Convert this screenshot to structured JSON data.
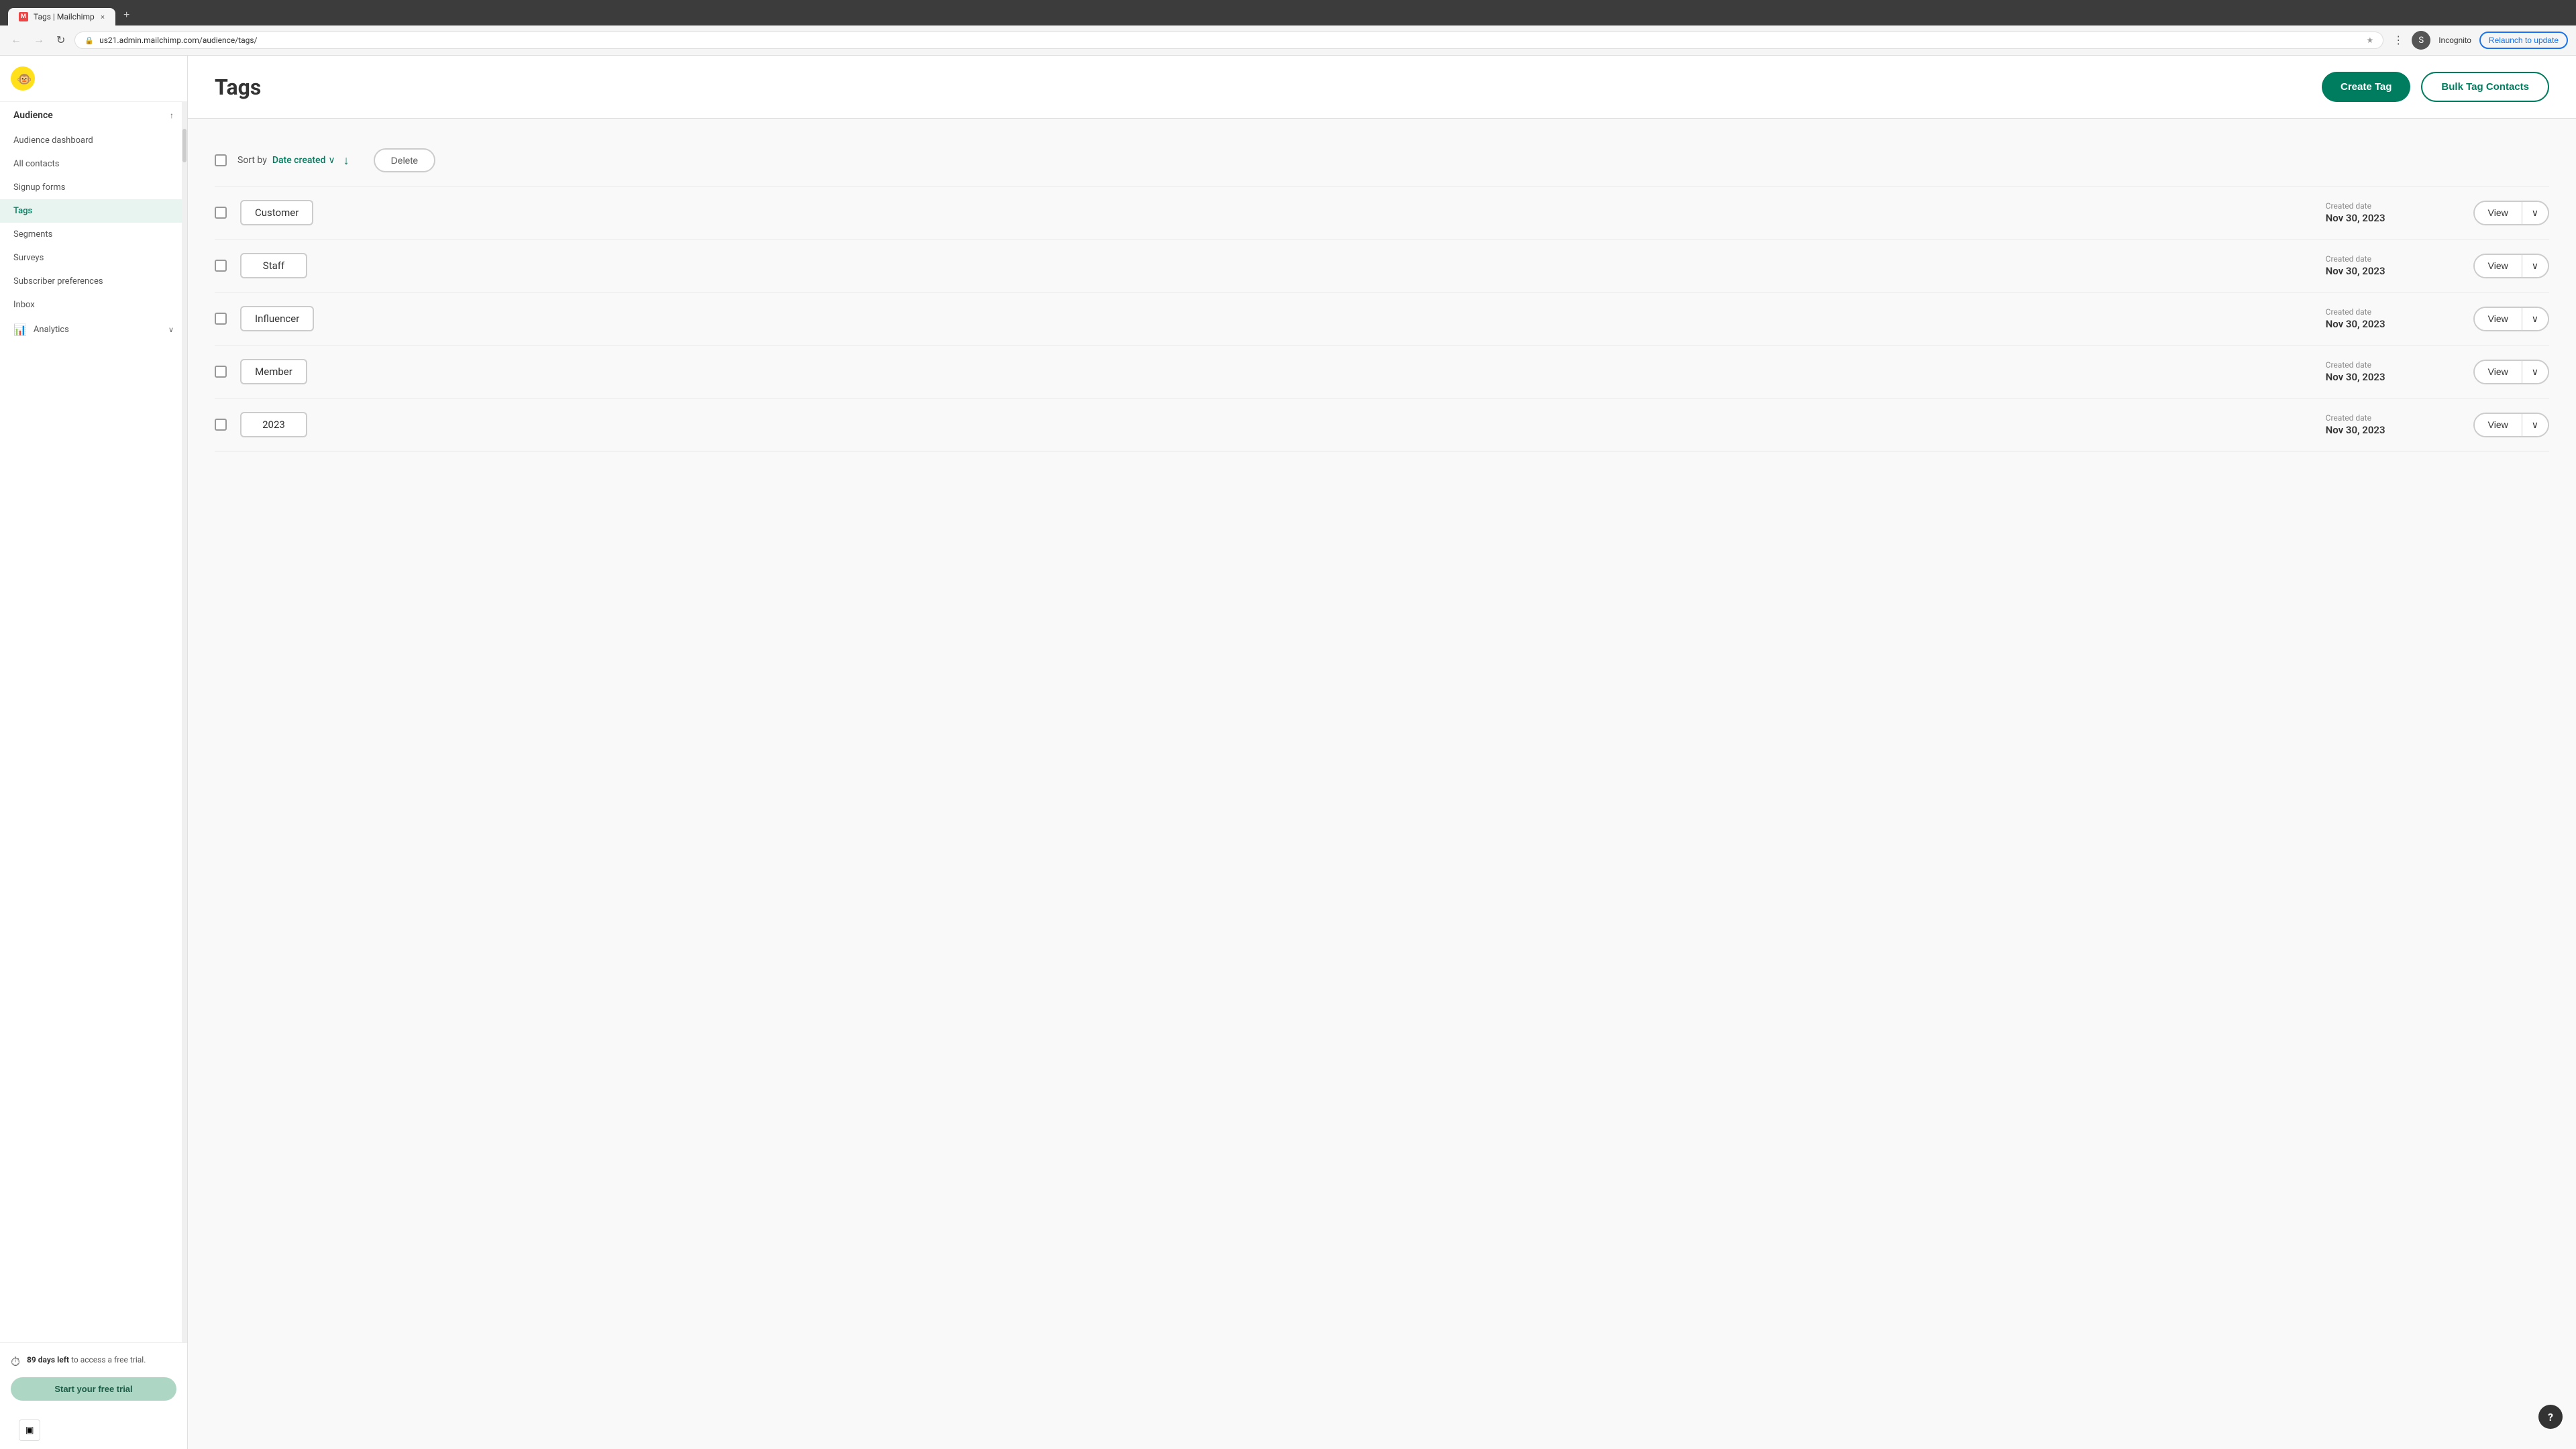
{
  "browser": {
    "tab_title": "Tags | Mailchimp",
    "tab_close": "×",
    "new_tab": "+",
    "url": "us21.admin.mailchimp.com/audience/tags/",
    "back_btn": "←",
    "forward_btn": "→",
    "refresh_btn": "↻",
    "bookmark_icon": "★",
    "incognito_label": "Incognito",
    "relaunch_label": "Relaunch to update"
  },
  "sidebar": {
    "section_title": "Audience",
    "collapse_icon": "↑",
    "items": [
      {
        "label": "Audience dashboard",
        "active": false
      },
      {
        "label": "All contacts",
        "active": false
      },
      {
        "label": "Signup forms",
        "active": false
      },
      {
        "label": "Tags",
        "active": true
      },
      {
        "label": "Segments",
        "active": false
      },
      {
        "label": "Surveys",
        "active": false
      },
      {
        "label": "Subscriber preferences",
        "active": false
      },
      {
        "label": "Inbox",
        "active": false
      }
    ],
    "analytics_label": "Analytics",
    "analytics_chevron": "∨",
    "trial": {
      "days_left": "89 days left",
      "description": " to access a free trial.",
      "cta": "Start your free trial"
    }
  },
  "page": {
    "title": "Tags"
  },
  "header_actions": {
    "create_tag": "Create Tag",
    "bulk_tag": "Bulk Tag Contacts"
  },
  "toolbar": {
    "sort_label": "Sort by",
    "sort_value": "Date created",
    "delete_label": "Delete"
  },
  "tags": [
    {
      "name": "Customer",
      "created_label": "Created date",
      "created_date": "Nov 30, 2023",
      "view_label": "View"
    },
    {
      "name": "Staff",
      "created_label": "Created date",
      "created_date": "Nov 30, 2023",
      "view_label": "View"
    },
    {
      "name": "Influencer",
      "created_label": "Created date",
      "created_date": "Nov 30, 2023",
      "view_label": "View"
    },
    {
      "name": "Member",
      "created_label": "Created date",
      "created_date": "Nov 30, 2023",
      "view_label": "View"
    },
    {
      "name": "2023",
      "created_label": "Created date",
      "created_date": "Nov 30, 2023",
      "view_label": "View"
    }
  ],
  "help": "?"
}
